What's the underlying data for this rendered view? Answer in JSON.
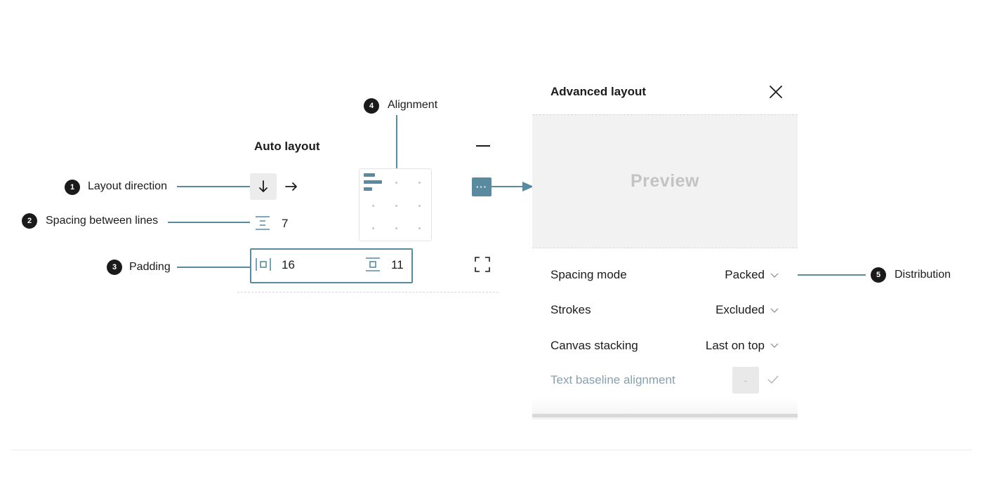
{
  "callouts": {
    "c1": {
      "num": "1",
      "label": "Layout direction"
    },
    "c2": {
      "num": "2",
      "label": "Spacing between lines"
    },
    "c3": {
      "num": "3",
      "label": "Padding"
    },
    "c4": {
      "num": "4",
      "label": "Alignment"
    },
    "c5": {
      "num": "5",
      "label": "Distribution"
    }
  },
  "auto_layout": {
    "title": "Auto layout",
    "direction_down_icon": "arrow-down-icon",
    "direction_right_icon": "arrow-right-icon",
    "line_spacing": "7",
    "padding_horizontal": "16",
    "padding_vertical": "11",
    "more_label": "···"
  },
  "advanced_layout": {
    "title": "Advanced layout",
    "preview": "Preview",
    "rows": [
      {
        "label": "Spacing mode",
        "value": "Packed"
      },
      {
        "label": "Strokes",
        "value": "Excluded"
      },
      {
        "label": "Canvas stacking",
        "value": "Last on top"
      },
      {
        "label": "Text baseline alignment",
        "value": "-"
      }
    ]
  },
  "colors": {
    "accent": "#5a8aa0",
    "badge": "#1a1a1a",
    "preview_bg": "#f2f2f2"
  }
}
